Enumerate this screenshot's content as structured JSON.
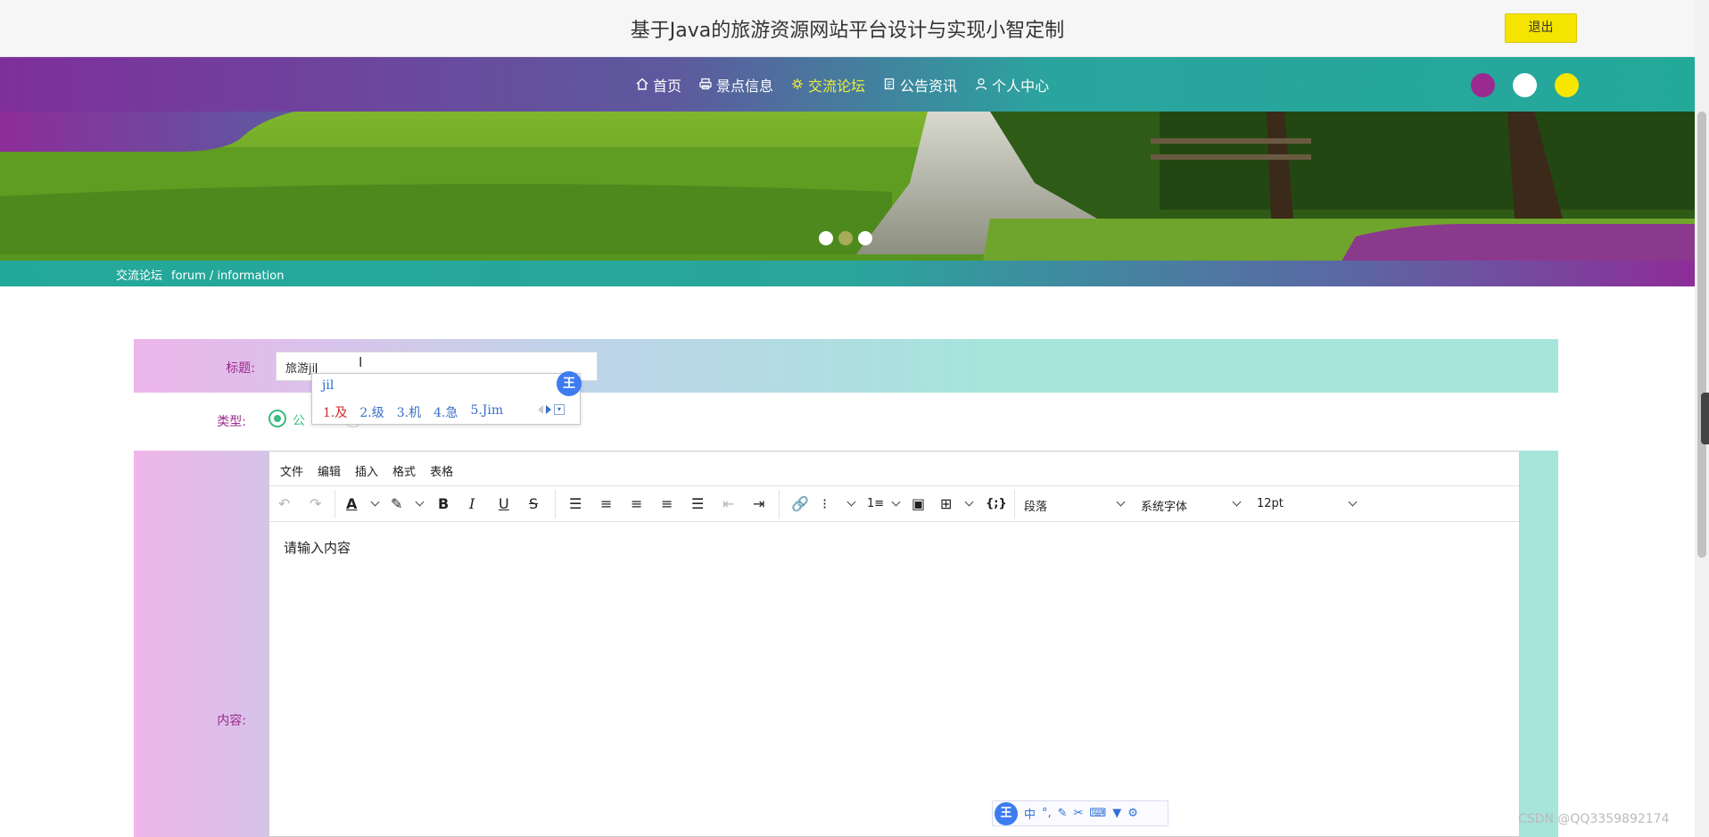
{
  "header": {
    "title": "基于Java的旅游资源网站平台设计与实现小智定制",
    "logout_label": "退出"
  },
  "nav": {
    "items": [
      {
        "label": "首页",
        "icon": "home-icon"
      },
      {
        "label": "景点信息",
        "icon": "printer-icon"
      },
      {
        "label": "交流论坛",
        "icon": "forum-icon",
        "active": true
      },
      {
        "label": "公告资讯",
        "icon": "document-icon"
      },
      {
        "label": "个人中心",
        "icon": "user-icon"
      }
    ],
    "active_color": "#f3ee3c",
    "theme_colors": [
      "#9b2a8f",
      "#ffffff",
      "#f7e600"
    ]
  },
  "banner": {
    "slide_count": 3,
    "active_slide": 2
  },
  "breadcrumb": {
    "primary": "交流论坛",
    "secondary": "forum / information"
  },
  "form": {
    "title_label": "标题:",
    "title_value": "旅游ji",
    "type_label": "类型:",
    "type_option_visible": "公",
    "content_label": "内容:"
  },
  "ime": {
    "pinyin": "jil",
    "logo": "王",
    "candidates": [
      "1.及",
      "2.级",
      "3.机",
      "4.急",
      "5.Jim"
    ]
  },
  "editor": {
    "menus": [
      "文件",
      "编辑",
      "插入",
      "格式",
      "表格"
    ],
    "block_format": "段落",
    "font_family": "系统字体",
    "font_size": "12pt",
    "placeholder": "请输入内容"
  },
  "ime_bar": {
    "logo": "王",
    "mode": "中",
    "icons": [
      "punctuation-icon",
      "pen-icon",
      "scissors-icon",
      "keyboard-icon",
      "skin-icon",
      "settings-icon"
    ]
  },
  "watermark": "CSDN @QQ3359892174",
  "colors": {
    "logout_bg": "#f5e400",
    "label_color": "#9c2a8c",
    "radio_color": "#3dbb82",
    "ime_blue": "#3d7cf0"
  }
}
